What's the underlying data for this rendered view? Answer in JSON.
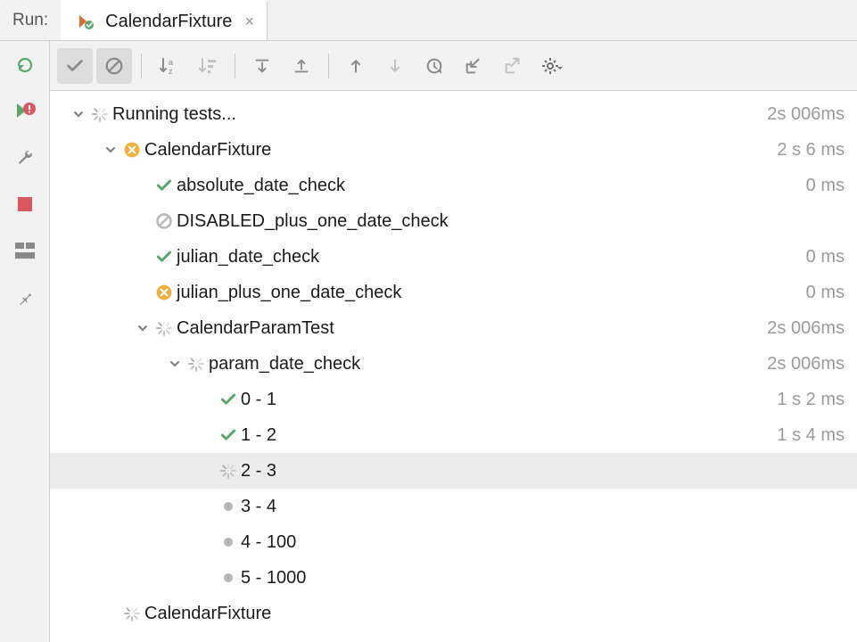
{
  "header": {
    "run_label": "Run:",
    "tab_title": "CalendarFixture"
  },
  "tree": {
    "nodes": [
      {
        "depth": 0,
        "expand": "down",
        "icon": "spinner",
        "label": "Running tests...",
        "time": "2s 006ms",
        "selected": false
      },
      {
        "depth": 1,
        "expand": "down",
        "icon": "fail-circle",
        "label": "CalendarFixture",
        "time": "2 s 6 ms",
        "selected": false
      },
      {
        "depth": 2,
        "expand": "",
        "icon": "pass-check",
        "label": "absolute_date_check",
        "time": "0 ms",
        "selected": false
      },
      {
        "depth": 2,
        "expand": "",
        "icon": "ignored",
        "label": "DISABLED_plus_one_date_check",
        "time": "",
        "selected": false
      },
      {
        "depth": 2,
        "expand": "",
        "icon": "pass-check",
        "label": "julian_date_check",
        "time": "0 ms",
        "selected": false
      },
      {
        "depth": 2,
        "expand": "",
        "icon": "fail-circle",
        "label": "julian_plus_one_date_check",
        "time": "0 ms",
        "selected": false
      },
      {
        "depth": 2,
        "expand": "down",
        "icon": "spinner",
        "label": "CalendarParamTest",
        "time": "2s 006ms",
        "selected": false
      },
      {
        "depth": 3,
        "expand": "down",
        "icon": "spinner",
        "label": "param_date_check",
        "time": "2s 006ms",
        "selected": false
      },
      {
        "depth": 4,
        "expand": "",
        "icon": "pass-check",
        "label": "0 - 1",
        "time": "1 s 2 ms",
        "selected": false
      },
      {
        "depth": 4,
        "expand": "",
        "icon": "pass-check",
        "label": "1 - 2",
        "time": "1 s 4 ms",
        "selected": false
      },
      {
        "depth": 4,
        "expand": "",
        "icon": "spinner",
        "label": "2 - 3",
        "time": "",
        "selected": true
      },
      {
        "depth": 4,
        "expand": "",
        "icon": "pending",
        "label": "3 - 4",
        "time": "",
        "selected": false
      },
      {
        "depth": 4,
        "expand": "",
        "icon": "pending",
        "label": "4 - 100",
        "time": "",
        "selected": false
      },
      {
        "depth": 4,
        "expand": "",
        "icon": "pending",
        "label": "5 - 1000",
        "time": "",
        "selected": false
      },
      {
        "depth": 1,
        "expand": "",
        "icon": "spinner",
        "label": "CalendarFixture",
        "time": "",
        "selected": false
      }
    ]
  },
  "colors": {
    "green": "#59a869",
    "orange": "#eeaf3b",
    "red": "#db5860",
    "grey": "#b8b8b8"
  }
}
